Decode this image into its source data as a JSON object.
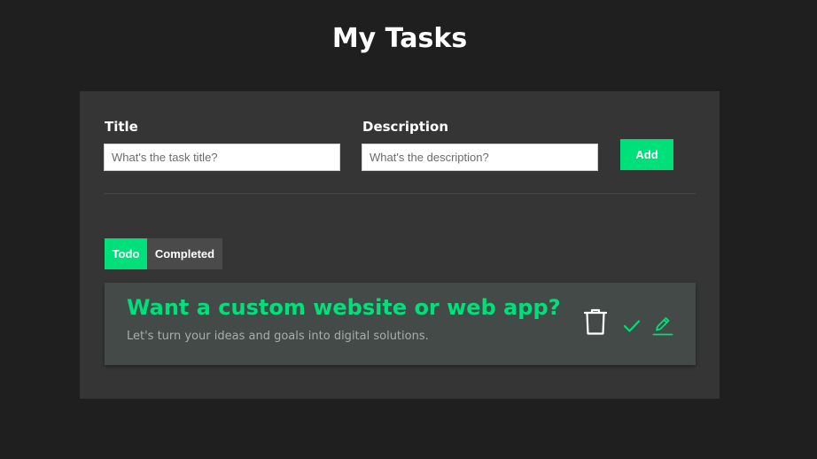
{
  "header": {
    "title": "My Tasks"
  },
  "form": {
    "title_label": "Title",
    "title_placeholder": "What's the task title?",
    "title_value": "",
    "description_label": "Description",
    "description_placeholder": "What's the description?",
    "description_value": "",
    "add_label": "Add"
  },
  "tabs": [
    {
      "label": "Todo",
      "active": true
    },
    {
      "label": "Completed",
      "active": false
    }
  ],
  "tasks": [
    {
      "title": "Want a custom website or web app?",
      "description": "Let's turn your ideas and goals into digital solutions.",
      "actions": [
        "trash-icon",
        "check-icon",
        "edit-icon"
      ]
    }
  ],
  "colors": {
    "background": "#1f1f1f",
    "panel": "#353535",
    "accent": "#00e07a",
    "card": "#434a48",
    "inactive_tab": "#4a4a4a"
  }
}
